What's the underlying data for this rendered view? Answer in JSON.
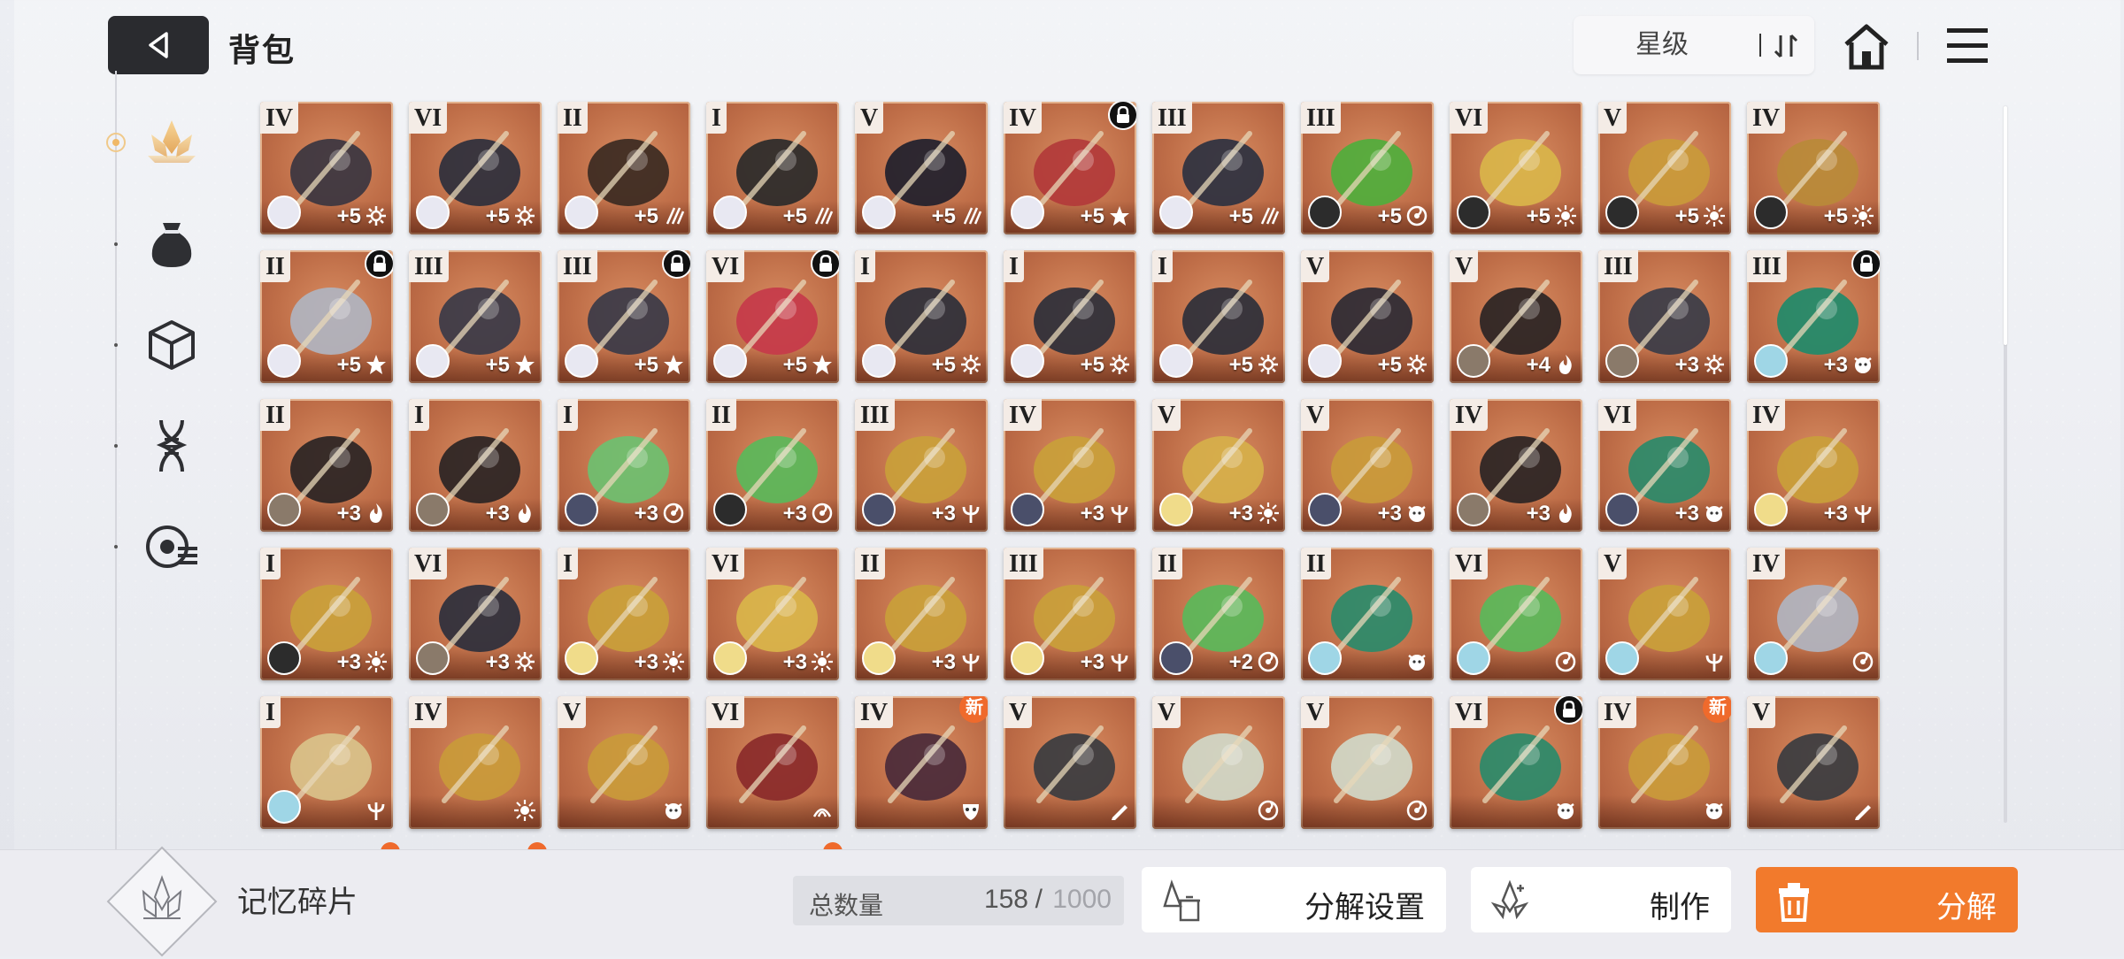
{
  "header": {
    "title": "背包",
    "sort_label": "星级"
  },
  "categories": [
    {
      "name": "memory-fragments",
      "icon": "crystal-flower-icon",
      "active": true
    },
    {
      "name": "materials",
      "icon": "pouch-icon",
      "active": false
    },
    {
      "name": "boxes",
      "icon": "cube-icon",
      "active": false
    },
    {
      "name": "gene",
      "icon": "dna-icon",
      "active": false
    },
    {
      "name": "misc",
      "icon": "target-list-icon",
      "active": false
    }
  ],
  "colors": {
    "accent_orange": "#f27a2c",
    "card_bg": "#bf6e48",
    "back_button": "#2a2b2f",
    "tier_badge": "#f4ece6"
  },
  "items": [
    {
      "tier": "IV",
      "level": "+5",
      "attr": "gear",
      "locked": false,
      "new": false,
      "avatar": "#e8e8f2",
      "art": "#3a3540"
    },
    {
      "tier": "VI",
      "level": "+5",
      "attr": "gear",
      "locked": false,
      "new": false,
      "avatar": "#e8e8f2",
      "art": "#2d2f3c"
    },
    {
      "tier": "II",
      "level": "+5",
      "attr": "claw",
      "locked": false,
      "new": false,
      "avatar": "#e8e8f2",
      "art": "#3b2a22"
    },
    {
      "tier": "I",
      "level": "+5",
      "attr": "claw",
      "locked": false,
      "new": false,
      "avatar": "#e8e8f2",
      "art": "#2a2a2a"
    },
    {
      "tier": "V",
      "level": "+5",
      "attr": "claw",
      "locked": false,
      "new": false,
      "avatar": "#e8e8f2",
      "art": "#20202c"
    },
    {
      "tier": "IV",
      "level": "+5",
      "attr": "star",
      "locked": true,
      "new": false,
      "avatar": "#e8e8f2",
      "art": "#b23a3a"
    },
    {
      "tier": "III",
      "level": "+5",
      "attr": "claw",
      "locked": false,
      "new": false,
      "avatar": "#e8e8f2",
      "art": "#2d3140"
    },
    {
      "tier": "III",
      "level": "+5",
      "attr": "swirl",
      "locked": false,
      "new": false,
      "avatar": "#2c2c2c",
      "art": "#4fae3c"
    },
    {
      "tier": "VI",
      "level": "+5",
      "attr": "sun",
      "locked": false,
      "new": false,
      "avatar": "#2c2c2c",
      "art": "#d9b54a"
    },
    {
      "tier": "V",
      "level": "+5",
      "attr": "sun",
      "locked": false,
      "new": false,
      "avatar": "#2c2c2c",
      "art": "#c99a3a"
    },
    {
      "tier": "IV",
      "level": "+5",
      "attr": "sun",
      "locked": false,
      "new": false,
      "avatar": "#2c2c2c",
      "art": "#b98a38"
    },
    {
      "tier": "II",
      "level": "+5",
      "attr": "star",
      "locked": true,
      "new": false,
      "avatar": "#e8e8f2",
      "art": "#b0b4c0"
    },
    {
      "tier": "III",
      "level": "+5",
      "attr": "star",
      "locked": false,
      "new": false,
      "avatar": "#e8e8f2",
      "art": "#3a3a48"
    },
    {
      "tier": "III",
      "level": "+5",
      "attr": "star",
      "locked": true,
      "new": false,
      "avatar": "#e8e8f2",
      "art": "#3a3a48"
    },
    {
      "tier": "VI",
      "level": "+5",
      "attr": "star",
      "locked": true,
      "new": false,
      "avatar": "#e8e8f2",
      "art": "#c63a4a"
    },
    {
      "tier": "I",
      "level": "+5",
      "attr": "gear",
      "locked": false,
      "new": false,
      "avatar": "#e8e8f2",
      "art": "#2c2f3a"
    },
    {
      "tier": "I",
      "level": "+5",
      "attr": "gear",
      "locked": false,
      "new": false,
      "avatar": "#e8e8f2",
      "art": "#2c2f3a"
    },
    {
      "tier": "I",
      "level": "+5",
      "attr": "gear",
      "locked": false,
      "new": false,
      "avatar": "#e8e8f2",
      "art": "#2c2f3a"
    },
    {
      "tier": "V",
      "level": "+5",
      "attr": "gear",
      "locked": false,
      "new": false,
      "avatar": "#e8e8f2",
      "art": "#2c2a34"
    },
    {
      "tier": "V",
      "level": "+4",
      "attr": "flame",
      "locked": false,
      "new": false,
      "avatar": "#8a7a6a",
      "art": "#2a2424"
    },
    {
      "tier": "III",
      "level": "+3",
      "attr": "gear",
      "locked": false,
      "new": false,
      "avatar": "#8a7a6a",
      "art": "#3a3c48"
    },
    {
      "tier": "III",
      "level": "+3",
      "attr": "lion",
      "locked": true,
      "new": false,
      "avatar": "#9fd6e6",
      "art": "#1f8a6a"
    },
    {
      "tier": "II",
      "level": "+3",
      "attr": "flame",
      "locked": false,
      "new": false,
      "avatar": "#8a7a6a",
      "art": "#2a2424"
    },
    {
      "tier": "I",
      "level": "+3",
      "attr": "flame",
      "locked": false,
      "new": false,
      "avatar": "#8a7a6a",
      "art": "#2a2424"
    },
    {
      "tier": "I",
      "level": "+3",
      "attr": "swirl",
      "locked": false,
      "new": false,
      "avatar": "#4a4f6a",
      "art": "#6cc070"
    },
    {
      "tier": "II",
      "level": "+3",
      "attr": "swirl",
      "locked": false,
      "new": false,
      "avatar": "#2c2c2c",
      "art": "#5ab85a"
    },
    {
      "tier": "III",
      "level": "+3",
      "attr": "trident",
      "locked": false,
      "new": false,
      "avatar": "#4a4f6a",
      "art": "#c9a03a"
    },
    {
      "tier": "IV",
      "level": "+3",
      "attr": "trident",
      "locked": false,
      "new": false,
      "avatar": "#4a4f6a",
      "art": "#c9a03a"
    },
    {
      "tier": "V",
      "level": "+3",
      "attr": "sun",
      "locked": false,
      "new": false,
      "avatar": "#f0dc8a",
      "art": "#d6b04a"
    },
    {
      "tier": "V",
      "level": "+3",
      "attr": "lion",
      "locked": false,
      "new": false,
      "avatar": "#4a4f6a",
      "art": "#c99a3a"
    },
    {
      "tier": "IV",
      "level": "+3",
      "attr": "flame",
      "locked": false,
      "new": false,
      "avatar": "#8a7a6a",
      "art": "#2a2424"
    },
    {
      "tier": "VI",
      "level": "+3",
      "attr": "lion",
      "locked": false,
      "new": false,
      "avatar": "#4a4f6a",
      "art": "#2a8a6a"
    },
    {
      "tier": "IV",
      "level": "+3",
      "attr": "trident",
      "locked": false,
      "new": false,
      "avatar": "#f0dc8a",
      "art": "#c9a03a"
    },
    {
      "tier": "I",
      "level": "+3",
      "attr": "sun",
      "locked": false,
      "new": false,
      "avatar": "#2c2c2c",
      "art": "#c9a03a"
    },
    {
      "tier": "VI",
      "level": "+3",
      "attr": "gear",
      "locked": false,
      "new": false,
      "avatar": "#8a7a6a",
      "art": "#2d2f3c"
    },
    {
      "tier": "I",
      "level": "+3",
      "attr": "sun",
      "locked": false,
      "new": false,
      "avatar": "#f0dc8a",
      "art": "#c9a03a"
    },
    {
      "tier": "VI",
      "level": "+3",
      "attr": "sun",
      "locked": false,
      "new": false,
      "avatar": "#f0dc8a",
      "art": "#d9b54a"
    },
    {
      "tier": "II",
      "level": "+3",
      "attr": "trident",
      "locked": false,
      "new": false,
      "avatar": "#f0dc8a",
      "art": "#c9a03a"
    },
    {
      "tier": "III",
      "level": "+3",
      "attr": "trident",
      "locked": false,
      "new": false,
      "avatar": "#f0dc8a",
      "art": "#c9a03a"
    },
    {
      "tier": "II",
      "level": "+2",
      "attr": "swirl",
      "locked": false,
      "new": false,
      "avatar": "#4a4f6a",
      "art": "#5ab85a"
    },
    {
      "tier": "II",
      "level": "",
      "attr": "lion",
      "locked": false,
      "new": false,
      "avatar": "#9fd6e6",
      "art": "#2a8a6a"
    },
    {
      "tier": "VI",
      "level": "",
      "attr": "swirl",
      "locked": false,
      "new": false,
      "avatar": "#9fd6e6",
      "art": "#5ab85a"
    },
    {
      "tier": "V",
      "level": "",
      "attr": "trident",
      "locked": false,
      "new": false,
      "avatar": "#9fd6e6",
      "art": "#c9a03a"
    },
    {
      "tier": "IV",
      "level": "",
      "attr": "swirl",
      "locked": false,
      "new": false,
      "avatar": "#9fd6e6",
      "art": "#b0b4c0"
    },
    {
      "tier": "I",
      "level": "",
      "attr": "trident",
      "locked": false,
      "new": false,
      "avatar": "#9fd6e6",
      "art": "#d9c28a"
    },
    {
      "tier": "IV",
      "level": "",
      "attr": "sun",
      "locked": false,
      "new": false,
      "avatar": "",
      "art": "#c99a3a"
    },
    {
      "tier": "V",
      "level": "",
      "attr": "lion",
      "locked": false,
      "new": false,
      "avatar": "",
      "art": "#c99a3a"
    },
    {
      "tier": "VI",
      "level": "",
      "attr": "claw2",
      "locked": false,
      "new": false,
      "avatar": "",
      "art": "#8a2a2a"
    },
    {
      "tier": "IV",
      "level": "",
      "attr": "mask",
      "locked": false,
      "new": true,
      "avatar": "",
      "art": "#4a2a3a"
    },
    {
      "tier": "V",
      "level": "",
      "attr": "pen",
      "locked": false,
      "new": false,
      "avatar": "",
      "art": "#3a3c40"
    },
    {
      "tier": "V",
      "level": "",
      "attr": "swirl",
      "locked": false,
      "new": false,
      "avatar": "",
      "art": "#d0d8c8"
    },
    {
      "tier": "V",
      "level": "",
      "attr": "swirl",
      "locked": false,
      "new": false,
      "avatar": "",
      "art": "#d0d8c8"
    },
    {
      "tier": "VI",
      "level": "",
      "attr": "lion",
      "locked": true,
      "new": true,
      "avatar": "",
      "art": "#2a8a6a"
    },
    {
      "tier": "IV",
      "level": "",
      "attr": "lion",
      "locked": false,
      "new": true,
      "avatar": "",
      "art": "#c99a3a"
    },
    {
      "tier": "V",
      "level": "",
      "attr": "pen",
      "locked": false,
      "new": false,
      "avatar": "",
      "art": "#3a3c40"
    }
  ],
  "bottom_bar": {
    "category_label": "记忆碎片",
    "count_label": "总数量",
    "count_current": "158",
    "count_separator": "/",
    "count_max": "1000",
    "decompose_settings_label": "分解设置",
    "craft_label": "制作",
    "decompose_label": "分解"
  }
}
